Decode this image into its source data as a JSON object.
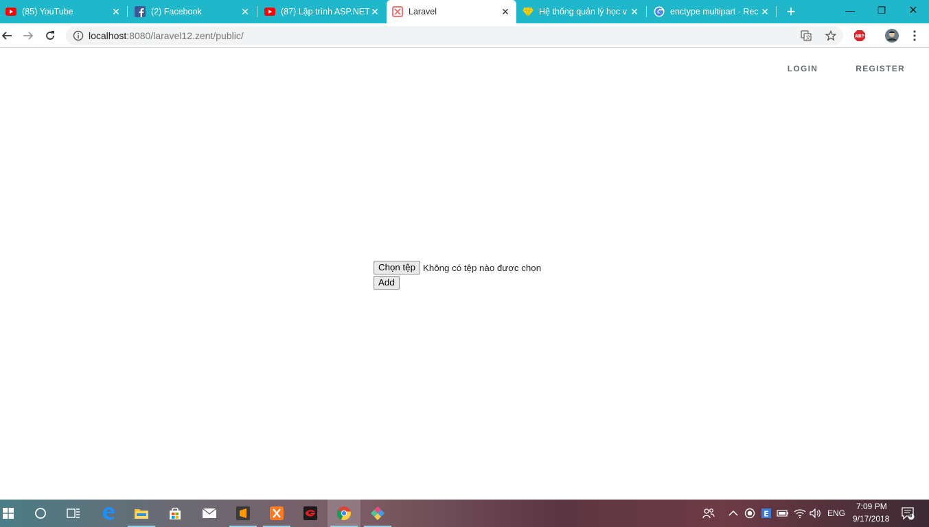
{
  "browser": {
    "tabs": [
      {
        "title": "(85) YouTube",
        "icon": "youtube-icon"
      },
      {
        "title": "(2) Facebook",
        "icon": "facebook-icon"
      },
      {
        "title": "(87) Lập trình ASP.NET",
        "icon": "youtube-icon"
      },
      {
        "title": "Laravel",
        "icon": "laravel-icon",
        "active": true
      },
      {
        "title": "Hệ thống quản lý học v",
        "icon": "diamond-icon"
      },
      {
        "title": "enctype multipart - Rec",
        "icon": "google-icon"
      }
    ],
    "url_host": "localhost",
    "url_path": ":8080/laravel12.zent/public/",
    "win_min": "—",
    "win_restore": "❐",
    "win_close": "✕",
    "new_tab": "+"
  },
  "page": {
    "nav": {
      "login": "LOGIN",
      "register": "REGISTER"
    },
    "file_button": "Chọn tệp",
    "file_status": "Không có tệp nào được chọn",
    "add_button": "Add"
  },
  "taskbar": {
    "lang": "ENG",
    "time": "7:09 PM",
    "date": "9/17/2018",
    "notifications": "4"
  }
}
